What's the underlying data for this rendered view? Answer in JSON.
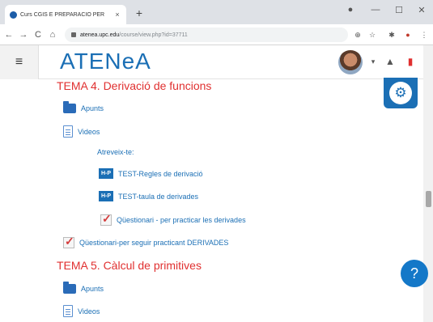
{
  "browser": {
    "tab_title": "Curs CGIS E PREPARACIÓ PER",
    "tab_close": "×",
    "new_tab": "+",
    "window_controls": [
      "●",
      "—",
      "☐",
      "✕"
    ],
    "nav": {
      "back": "←",
      "forward": "→",
      "reload": "C",
      "home": "⌂"
    },
    "url_host": "atenea.upc.edu",
    "url_path": "/course/view.php?id=37711",
    "toolbar_icons": [
      "⊕",
      "☆",
      "✱",
      "●",
      "⋮"
    ]
  },
  "header": {
    "menu_icon": "≡",
    "logo": "ATENeA",
    "icons": [
      "▾",
      "▲",
      "▮"
    ]
  },
  "sections": [
    {
      "title": "TEMA 4. Derivació de funcions",
      "activities": [
        {
          "type": "folder",
          "label": "Apunts"
        },
        {
          "type": "page",
          "label": "Videos"
        }
      ],
      "label": "Atreveix-te:",
      "sub_activities": [
        {
          "type": "hotpot",
          "icon": "H-P",
          "label": "TEST-Regles de derivació"
        },
        {
          "type": "hotpot",
          "icon": "H-P",
          "label": "TEST-taula de derivades"
        },
        {
          "type": "quiz",
          "label": "Qüestionari - per practicar les derivades"
        }
      ],
      "after": {
        "type": "quiz",
        "label": "Qüestionari-per seguir practicant DERIVADES"
      }
    },
    {
      "title": "TEMA 5. Càlcul de primitives",
      "activities": [
        {
          "type": "folder",
          "label": "Apunts"
        },
        {
          "type": "page",
          "label": "Videos"
        }
      ]
    }
  ],
  "floating": {
    "gear": "⚙",
    "help": "?"
  },
  "colors": {
    "accent": "#1b6fb5",
    "section_title": "#e03030"
  }
}
